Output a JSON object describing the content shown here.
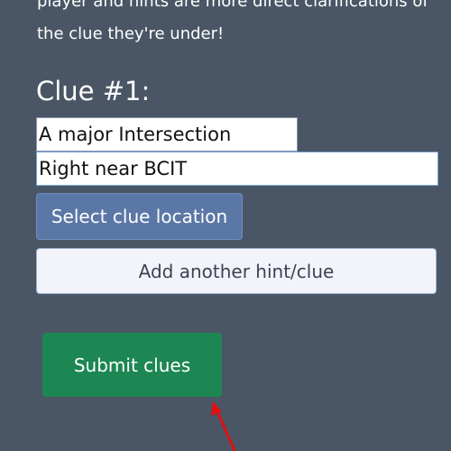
{
  "intro": {
    "text": "player and hints are more direct clarifications of the clue they're under!"
  },
  "clue": {
    "heading": "Clue #1:",
    "hints": [
      {
        "value": "A major Intersection"
      },
      {
        "value": "Right near BCIT"
      }
    ]
  },
  "buttons": {
    "select_location": "Select clue location",
    "add_hint": "Add another hint/clue",
    "submit": "Submit clues"
  },
  "colors": {
    "background": "#4a5665",
    "select_location": "#5b77a6",
    "add_hint": "#f3f4fb",
    "submit": "#1c8753",
    "annotation_arrow": "#e01010"
  }
}
